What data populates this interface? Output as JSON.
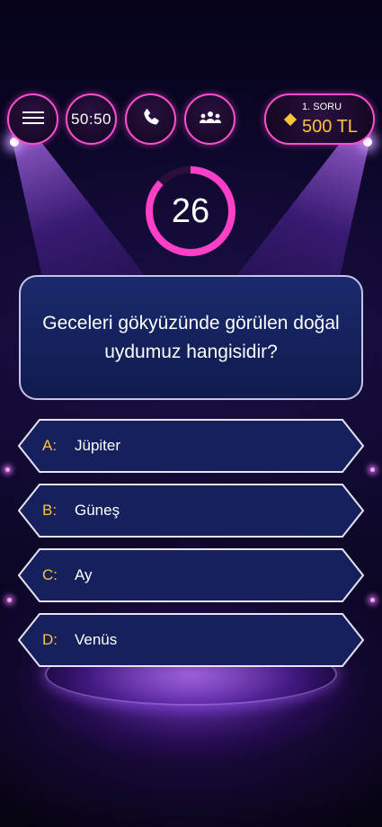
{
  "lifelines": {
    "menu_icon": "hamburger-icon",
    "fifty_fifty_label": "50:50",
    "phone_icon": "phone-icon",
    "audience_icon": "audience-icon"
  },
  "prize": {
    "question_label": "1. SORU",
    "amount": "500 TL",
    "accent_color": "#ffc23b"
  },
  "timer": {
    "seconds": "26",
    "remaining_fraction": 0.87,
    "ring_color": "#ff3fc8"
  },
  "question": {
    "text": "Geceleri gökyüzünde görülen doğal uydumuz hangisidir?"
  },
  "answers": [
    {
      "letter": "A:",
      "text": "Jüpiter"
    },
    {
      "letter": "B:",
      "text": "Güneş"
    },
    {
      "letter": "C:",
      "text": "Ay"
    },
    {
      "letter": "D:",
      "text": "Venüs"
    }
  ]
}
